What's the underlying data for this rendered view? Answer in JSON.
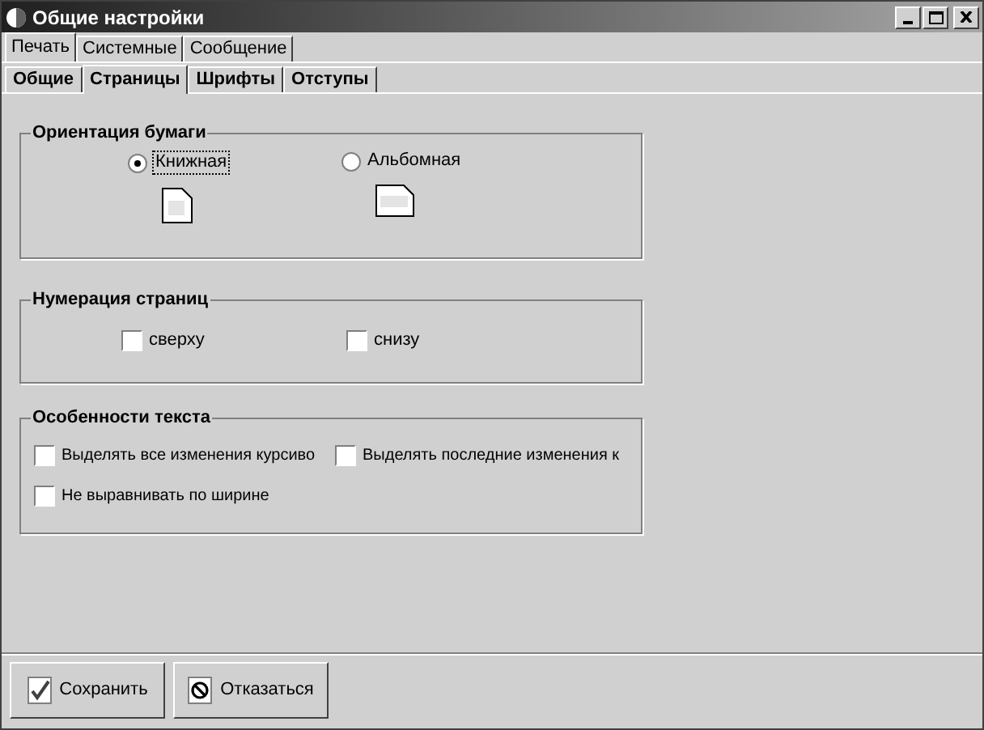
{
  "window": {
    "title": "Общие настройки"
  },
  "tabs": [
    {
      "label": "Печать",
      "selected": true
    },
    {
      "label": "Системные",
      "selected": false
    },
    {
      "label": "Сообщение",
      "selected": false
    }
  ],
  "subtabs": [
    {
      "label": "Общие",
      "selected": false
    },
    {
      "label": "Страницы",
      "selected": true
    },
    {
      "label": "Шрифты",
      "selected": false
    },
    {
      "label": "Отступы",
      "selected": false
    }
  ],
  "orientation": {
    "title": "Ориентация бумаги",
    "options": [
      {
        "label": "Книжная",
        "selected": true,
        "kind": "portrait"
      },
      {
        "label": "Альбомная",
        "selected": false,
        "kind": "landscape"
      }
    ]
  },
  "numbering": {
    "title": "Нумерация страниц",
    "options": [
      {
        "label": "сверху",
        "checked": false
      },
      {
        "label": "снизу",
        "checked": false
      }
    ]
  },
  "text_features": {
    "title": "Особенности текста",
    "options": [
      {
        "label": "Выделять все изменения курсиво",
        "checked": false
      },
      {
        "label": "Выделять последние изменения к",
        "checked": false
      },
      {
        "label": "Не выравнивать по ширине",
        "checked": false
      }
    ]
  },
  "buttons": [
    {
      "label": "Сохранить",
      "kind": "save"
    },
    {
      "label": "Отказаться",
      "kind": "cancel"
    }
  ]
}
